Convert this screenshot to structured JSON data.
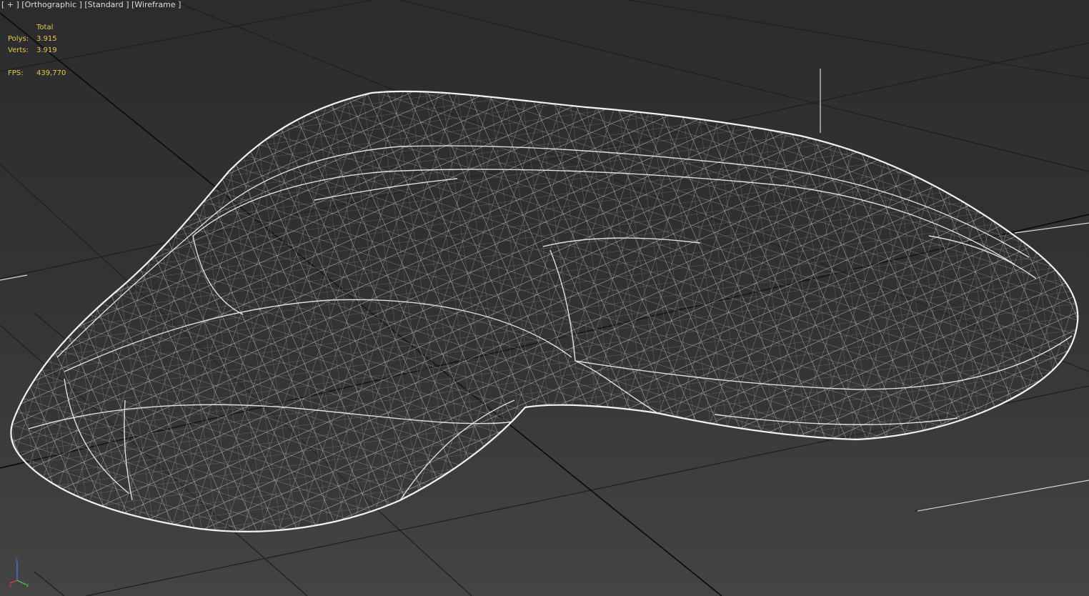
{
  "viewport": {
    "labels": [
      "[ + ]",
      "[Orthographic ]",
      "[Standard ]",
      "[Wireframe ]"
    ]
  },
  "stats": {
    "header": "Total",
    "polys_label": "Polys:",
    "polys_value": "3.915",
    "verts_label": "Verts:",
    "verts_value": "3.919",
    "fps_label": "FPS:",
    "fps_value": "439,770"
  },
  "gizmo": {
    "x_label": "x",
    "y_label": "y",
    "z_label": "z",
    "colors": {
      "x": "#d23c3c",
      "y": "#4cc24c",
      "z": "#4a6ee0"
    }
  },
  "colors": {
    "background_top": "#2c2c2c",
    "background_bottom": "#444444",
    "grid_line": "#1e1e1e",
    "grid_axis": "#0a0a0a",
    "wireframe": "#e6e6e6",
    "stats_text": "#e8c84a",
    "label_text": "#dcdcdc"
  },
  "model": {
    "render_mode": "wireframe"
  }
}
